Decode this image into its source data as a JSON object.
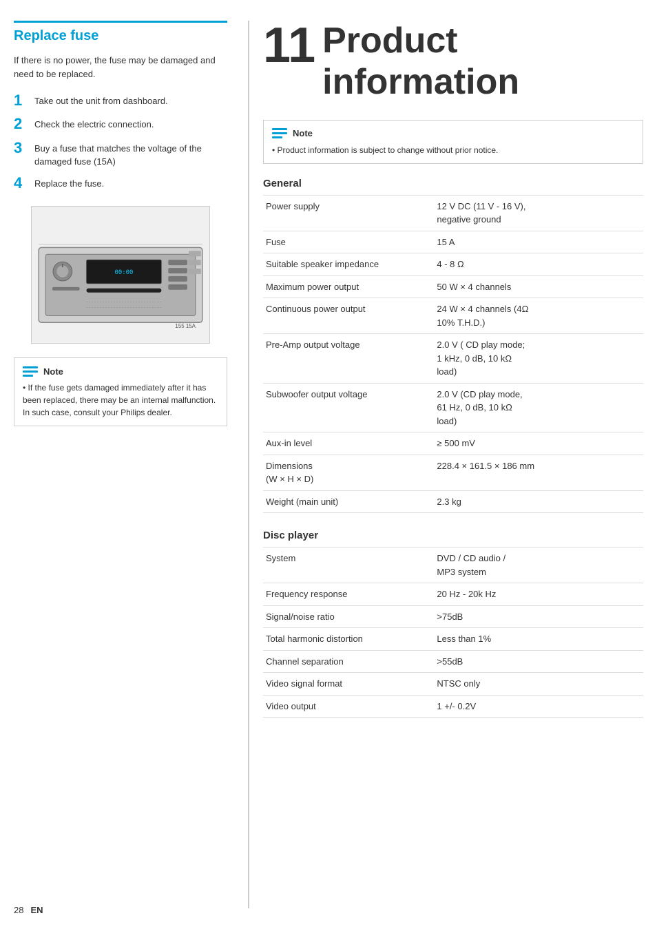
{
  "left": {
    "section_title": "Replace fuse",
    "intro": "If there is no power, the fuse may be damaged and need to be replaced.",
    "steps": [
      {
        "number": "1",
        "text": "Take out the unit from dashboard."
      },
      {
        "number": "2",
        "text": "Check the electric connection."
      },
      {
        "number": "3",
        "text": "Buy a fuse that matches the voltage of the damaged fuse (15A)"
      },
      {
        "number": "4",
        "text": "Replace the fuse."
      }
    ],
    "note": {
      "label": "Note",
      "text": "If the fuse gets damaged immediately after it has been replaced, there may be an internal malfunction. In such case, consult your Philips dealer."
    }
  },
  "right": {
    "chapter_number": "11",
    "chapter_title": "Product\ninformation",
    "note": {
      "label": "Note",
      "text": "Product information is subject to change without prior notice."
    },
    "general": {
      "title": "General",
      "specs": [
        {
          "label": "Power supply",
          "value": "12 V DC (11 V - 16 V),\nnegative ground"
        },
        {
          "label": "Fuse",
          "value": "15 A"
        },
        {
          "label": "Suitable speaker impedance",
          "value": "4 - 8 Ω"
        },
        {
          "label": "Maximum power output",
          "value": "50 W × 4 channels"
        },
        {
          "label": "Continuous power output",
          "value": "24 W × 4 channels (4Ω\n10% T.H.D.)"
        },
        {
          "label": "Pre-Amp output voltage",
          "value": "2.0 V ( CD play mode;\n1 kHz, 0 dB, 10 kΩ\nload)"
        },
        {
          "label": "Subwoofer output voltage",
          "value": "2.0 V (CD play mode,\n61 Hz, 0 dB, 10 kΩ\nload)"
        },
        {
          "label": "Aux-in level",
          "value": "≥ 500 mV"
        },
        {
          "label": "Dimensions\n(W × H × D)",
          "value": "228.4 × 161.5 × 186 mm"
        },
        {
          "label": "Weight (main unit)",
          "value": "2.3 kg"
        }
      ]
    },
    "disc_player": {
      "title": "Disc player",
      "specs": [
        {
          "label": "System",
          "value": "DVD / CD audio /\nMP3 system"
        },
        {
          "label": "Frequency response",
          "value": "20 Hz - 20k Hz"
        },
        {
          "label": "Signal/noise ratio",
          "value": ">75dB"
        },
        {
          "label": "Total harmonic distortion",
          "value": "Less than 1%"
        },
        {
          "label": "Channel separation",
          "value": ">55dB"
        },
        {
          "label": "Video signal format",
          "value": "NTSC only"
        },
        {
          "label": "Video output",
          "value": "1 +/- 0.2V"
        }
      ]
    }
  },
  "footer": {
    "page_number": "28",
    "language": "EN"
  }
}
